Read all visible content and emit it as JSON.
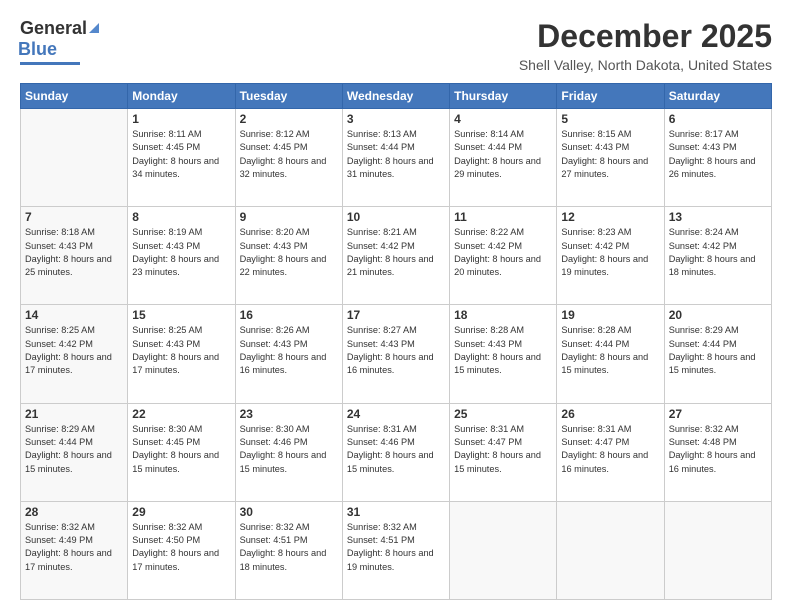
{
  "header": {
    "logo": {
      "general": "General",
      "blue": "Blue"
    },
    "title": "December 2025",
    "subtitle": "Shell Valley, North Dakota, United States"
  },
  "weekdays": [
    "Sunday",
    "Monday",
    "Tuesday",
    "Wednesday",
    "Thursday",
    "Friday",
    "Saturday"
  ],
  "weeks": [
    [
      {
        "day": "",
        "info": ""
      },
      {
        "day": "1",
        "info": "Sunrise: 8:11 AM\nSunset: 4:45 PM\nDaylight: 8 hours\nand 34 minutes."
      },
      {
        "day": "2",
        "info": "Sunrise: 8:12 AM\nSunset: 4:45 PM\nDaylight: 8 hours\nand 32 minutes."
      },
      {
        "day": "3",
        "info": "Sunrise: 8:13 AM\nSunset: 4:44 PM\nDaylight: 8 hours\nand 31 minutes."
      },
      {
        "day": "4",
        "info": "Sunrise: 8:14 AM\nSunset: 4:44 PM\nDaylight: 8 hours\nand 29 minutes."
      },
      {
        "day": "5",
        "info": "Sunrise: 8:15 AM\nSunset: 4:43 PM\nDaylight: 8 hours\nand 27 minutes."
      },
      {
        "day": "6",
        "info": "Sunrise: 8:17 AM\nSunset: 4:43 PM\nDaylight: 8 hours\nand 26 minutes."
      }
    ],
    [
      {
        "day": "7",
        "info": "Sunrise: 8:18 AM\nSunset: 4:43 PM\nDaylight: 8 hours\nand 25 minutes."
      },
      {
        "day": "8",
        "info": "Sunrise: 8:19 AM\nSunset: 4:43 PM\nDaylight: 8 hours\nand 23 minutes."
      },
      {
        "day": "9",
        "info": "Sunrise: 8:20 AM\nSunset: 4:43 PM\nDaylight: 8 hours\nand 22 minutes."
      },
      {
        "day": "10",
        "info": "Sunrise: 8:21 AM\nSunset: 4:42 PM\nDaylight: 8 hours\nand 21 minutes."
      },
      {
        "day": "11",
        "info": "Sunrise: 8:22 AM\nSunset: 4:42 PM\nDaylight: 8 hours\nand 20 minutes."
      },
      {
        "day": "12",
        "info": "Sunrise: 8:23 AM\nSunset: 4:42 PM\nDaylight: 8 hours\nand 19 minutes."
      },
      {
        "day": "13",
        "info": "Sunrise: 8:24 AM\nSunset: 4:42 PM\nDaylight: 8 hours\nand 18 minutes."
      }
    ],
    [
      {
        "day": "14",
        "info": "Sunrise: 8:25 AM\nSunset: 4:42 PM\nDaylight: 8 hours\nand 17 minutes."
      },
      {
        "day": "15",
        "info": "Sunrise: 8:25 AM\nSunset: 4:43 PM\nDaylight: 8 hours\nand 17 minutes."
      },
      {
        "day": "16",
        "info": "Sunrise: 8:26 AM\nSunset: 4:43 PM\nDaylight: 8 hours\nand 16 minutes."
      },
      {
        "day": "17",
        "info": "Sunrise: 8:27 AM\nSunset: 4:43 PM\nDaylight: 8 hours\nand 16 minutes."
      },
      {
        "day": "18",
        "info": "Sunrise: 8:28 AM\nSunset: 4:43 PM\nDaylight: 8 hours\nand 15 minutes."
      },
      {
        "day": "19",
        "info": "Sunrise: 8:28 AM\nSunset: 4:44 PM\nDaylight: 8 hours\nand 15 minutes."
      },
      {
        "day": "20",
        "info": "Sunrise: 8:29 AM\nSunset: 4:44 PM\nDaylight: 8 hours\nand 15 minutes."
      }
    ],
    [
      {
        "day": "21",
        "info": "Sunrise: 8:29 AM\nSunset: 4:44 PM\nDaylight: 8 hours\nand 15 minutes."
      },
      {
        "day": "22",
        "info": "Sunrise: 8:30 AM\nSunset: 4:45 PM\nDaylight: 8 hours\nand 15 minutes."
      },
      {
        "day": "23",
        "info": "Sunrise: 8:30 AM\nSunset: 4:46 PM\nDaylight: 8 hours\nand 15 minutes."
      },
      {
        "day": "24",
        "info": "Sunrise: 8:31 AM\nSunset: 4:46 PM\nDaylight: 8 hours\nand 15 minutes."
      },
      {
        "day": "25",
        "info": "Sunrise: 8:31 AM\nSunset: 4:47 PM\nDaylight: 8 hours\nand 15 minutes."
      },
      {
        "day": "26",
        "info": "Sunrise: 8:31 AM\nSunset: 4:47 PM\nDaylight: 8 hours\nand 16 minutes."
      },
      {
        "day": "27",
        "info": "Sunrise: 8:32 AM\nSunset: 4:48 PM\nDaylight: 8 hours\nand 16 minutes."
      }
    ],
    [
      {
        "day": "28",
        "info": "Sunrise: 8:32 AM\nSunset: 4:49 PM\nDaylight: 8 hours\nand 17 minutes."
      },
      {
        "day": "29",
        "info": "Sunrise: 8:32 AM\nSunset: 4:50 PM\nDaylight: 8 hours\nand 17 minutes."
      },
      {
        "day": "30",
        "info": "Sunrise: 8:32 AM\nSunset: 4:51 PM\nDaylight: 8 hours\nand 18 minutes."
      },
      {
        "day": "31",
        "info": "Sunrise: 8:32 AM\nSunset: 4:51 PM\nDaylight: 8 hours\nand 19 minutes."
      },
      {
        "day": "",
        "info": ""
      },
      {
        "day": "",
        "info": ""
      },
      {
        "day": "",
        "info": ""
      }
    ]
  ]
}
